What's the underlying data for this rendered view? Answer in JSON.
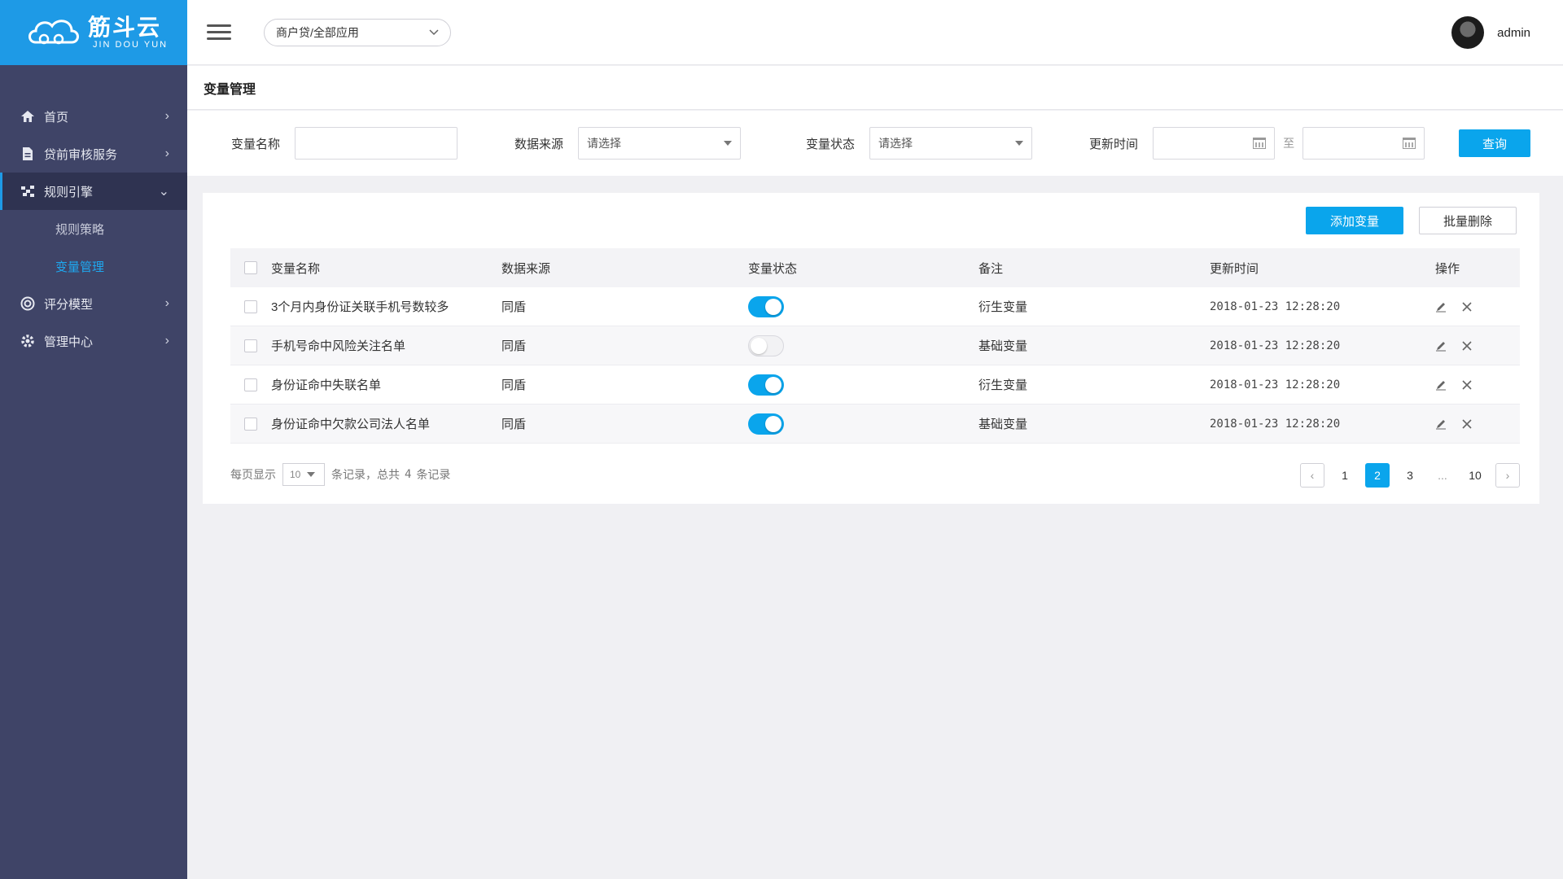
{
  "brand": {
    "name_cn": "筋斗云",
    "name_en": "JIN DOU YUN"
  },
  "header": {
    "app_selector": "商户贷/全部应用",
    "username": "admin"
  },
  "sidebar": {
    "items": [
      {
        "label": "首页",
        "icon": "home-icon"
      },
      {
        "label": "贷前审核服务",
        "icon": "document-icon"
      },
      {
        "label": "规则引擎",
        "icon": "rules-icon",
        "expanded": true,
        "children": [
          {
            "label": "规则策略"
          },
          {
            "label": "变量管理",
            "current": true
          }
        ]
      },
      {
        "label": "评分模型",
        "icon": "target-icon"
      },
      {
        "label": "管理中心",
        "icon": "gear-icon"
      }
    ]
  },
  "page": {
    "title": "变量管理"
  },
  "filters": {
    "name_label": "变量名称",
    "name_value": "",
    "source_label": "数据来源",
    "source_placeholder": "请选择",
    "status_label": "变量状态",
    "status_placeholder": "请选择",
    "time_label": "更新时间",
    "time_sep": "至",
    "query_button": "查询"
  },
  "actions": {
    "add": "添加变量",
    "batch_delete": "批量删除"
  },
  "table": {
    "headers": [
      "变量名称",
      "数据来源",
      "变量状态",
      "备注",
      "更新时间",
      "操作"
    ],
    "rows": [
      {
        "name": "3个月内身份证关联手机号数较多",
        "source": "同盾",
        "enabled": true,
        "note": "衍生变量",
        "time": "2018-01-23 12:28:20"
      },
      {
        "name": "手机号命中风险关注名单",
        "source": "同盾",
        "enabled": false,
        "note": "基础变量",
        "time": "2018-01-23 12:28:20"
      },
      {
        "name": "身份证命中失联名单",
        "source": "同盾",
        "enabled": true,
        "note": "衍生变量",
        "time": "2018-01-23 12:28:20"
      },
      {
        "name": "身份证命中欠款公司法人名单",
        "source": "同盾",
        "enabled": true,
        "note": "基础变量",
        "time": "2018-01-23 12:28:20"
      }
    ]
  },
  "pagination": {
    "per_page_label": "每页显示",
    "per_page": "10",
    "summary_prefix": "条记录，总共",
    "total": "4",
    "summary_suffix": "条记录",
    "pages": [
      "1",
      "2",
      "3",
      "...",
      "10"
    ],
    "current": "2"
  },
  "colors": {
    "accent": "#0aa5ec",
    "sidebar": "#3f4467",
    "logo_bg": "#1e9ae6"
  }
}
